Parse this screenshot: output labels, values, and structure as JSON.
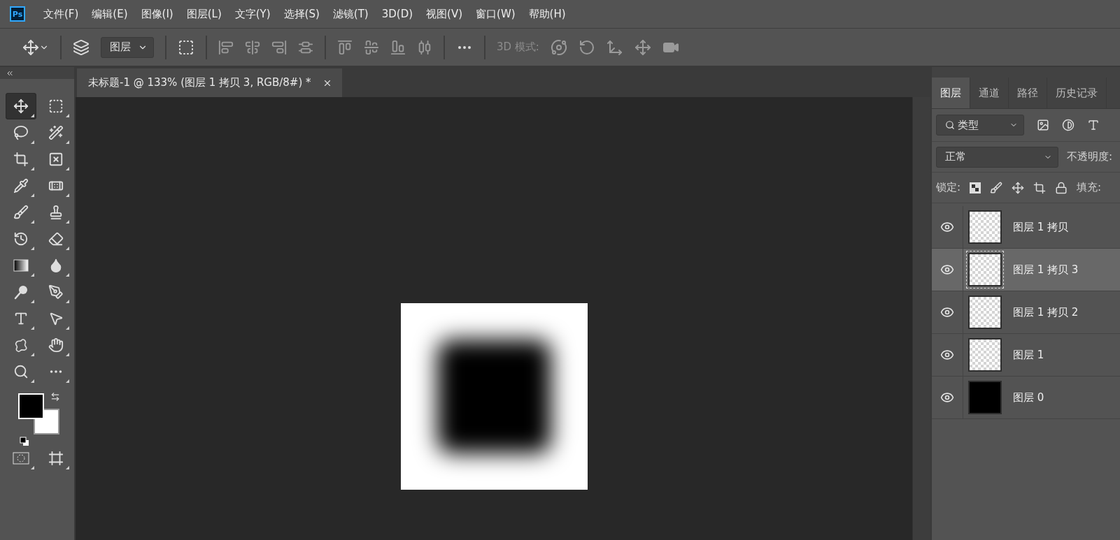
{
  "menu": {
    "logo": "Ps",
    "items": [
      "文件(F)",
      "编辑(E)",
      "图像(I)",
      "图层(L)",
      "文字(Y)",
      "选择(S)",
      "滤镜(T)",
      "3D(D)",
      "视图(V)",
      "窗口(W)",
      "帮助(H)"
    ]
  },
  "options_bar": {
    "layer_select": "图层",
    "mode_label": "3D 模式:"
  },
  "tools": [
    {
      "selected": true
    },
    {
      "selected": false
    },
    {
      "selected": false
    },
    {
      "selected": false
    },
    {
      "selected": false
    },
    {
      "selected": false
    },
    {
      "selected": false
    },
    {
      "selected": false
    },
    {
      "selected": false
    },
    {
      "selected": false
    },
    {
      "selected": false
    },
    {
      "selected": false
    },
    {
      "selected": false
    },
    {
      "selected": false
    },
    {
      "selected": false
    },
    {
      "selected": false
    },
    {
      "selected": false
    },
    {
      "selected": false
    },
    {
      "selected": false
    },
    {
      "selected": false
    },
    {
      "selected": false
    },
    {
      "selected": false
    }
  ],
  "document_tab": {
    "title": "未标题-1 @ 133% (图层 1 拷贝 3, RGB/8#) *"
  },
  "layers_panel": {
    "tabs": [
      {
        "label": "图层",
        "selected": true
      },
      {
        "label": "通道",
        "selected": false
      },
      {
        "label": "路径",
        "selected": false
      },
      {
        "label": "历史记录",
        "selected": false
      }
    ],
    "filter": "类型",
    "blend_mode": "正常",
    "opacity_label": "不透明度:",
    "lock_label": "锁定:",
    "fill_label": "填充:",
    "layers": [
      {
        "name": "图层 1 拷贝",
        "visible": true,
        "selected": false,
        "kind": "transparent"
      },
      {
        "name": "图层 1 拷贝 3",
        "visible": true,
        "selected": true,
        "kind": "transparent"
      },
      {
        "name": "图层 1 拷贝 2",
        "visible": true,
        "selected": false,
        "kind": "transparent"
      },
      {
        "name": "图层 1",
        "visible": true,
        "selected": false,
        "kind": "transparent"
      },
      {
        "name": "图层 0",
        "visible": true,
        "selected": false,
        "kind": "filled"
      }
    ]
  }
}
